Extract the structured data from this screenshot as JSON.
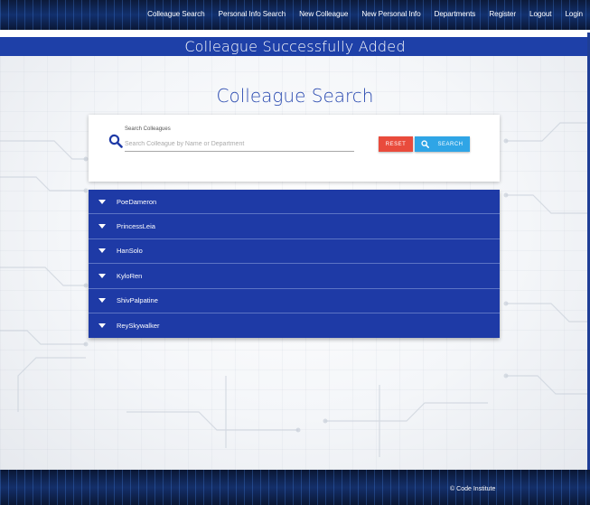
{
  "nav": {
    "links": [
      "Colleague Search",
      "Personal Info Search",
      "New Colleague",
      "New Personal Info",
      "Departments",
      "Register",
      "Logout",
      "Login"
    ]
  },
  "flash": {
    "message": "Colleague Successfully Added"
  },
  "page": {
    "title": "Colleague Search"
  },
  "search": {
    "label": "Search Colleagues",
    "placeholder": "Search Colleague by Name or Department",
    "value": "",
    "reset_label": "RESET",
    "search_label": "SEARCH"
  },
  "colleagues": [
    "PoeDameron",
    "PrincessLeia",
    "HanSolo",
    "KyloRen",
    "ShivPalpatine",
    "ReySkywalker"
  ],
  "footer": {
    "copy_icon": "copyright-icon",
    "text": "Code Institute"
  },
  "colors": {
    "primary": "#1e3aa6",
    "reset": "#e94b3c",
    "search": "#2fa5e6"
  }
}
